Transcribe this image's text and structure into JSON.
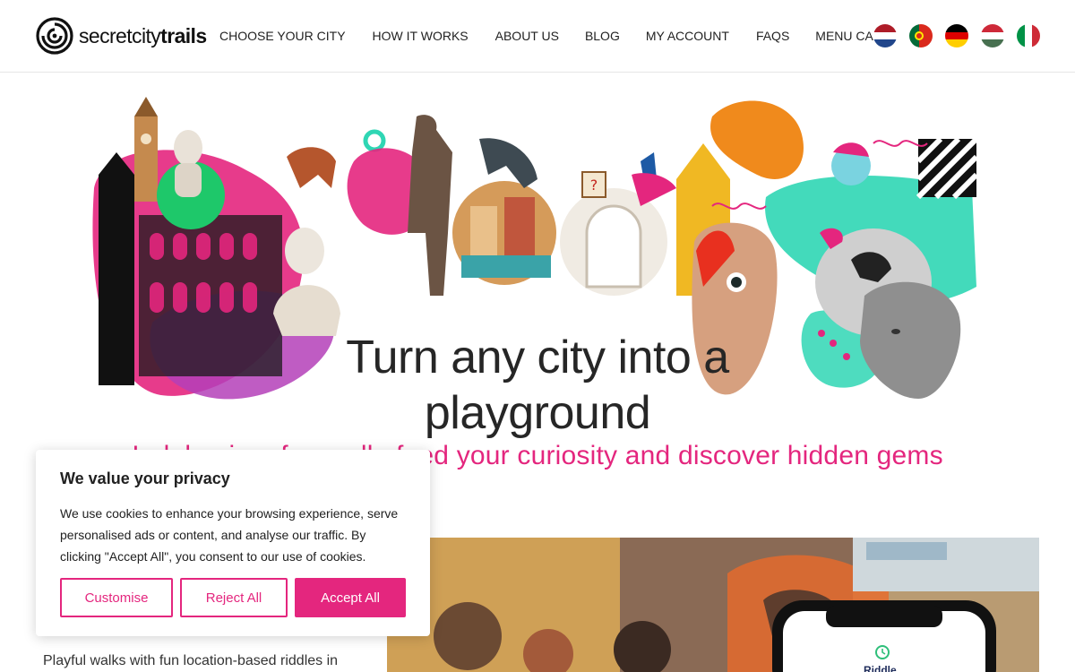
{
  "brand": {
    "name_light": "secret",
    "name_bold": "city",
    "name_end": "trails"
  },
  "nav": {
    "items": [
      "CHOOSE YOUR CITY",
      "HOW IT WORKS",
      "ABOUT US",
      "BLOG",
      "MY ACCOUNT",
      "FAQS",
      "MENU CART"
    ]
  },
  "languages": [
    {
      "code": "nl",
      "icon": "netherlands-flag-icon"
    },
    {
      "code": "pt",
      "icon": "portugal-flag-icon"
    },
    {
      "code": "de",
      "icon": "germany-flag-icon"
    },
    {
      "code": "hu",
      "icon": "hungary-flag-icon"
    },
    {
      "code": "it",
      "icon": "italy-flag-icon"
    }
  ],
  "hero": {
    "headline_line1": "Turn any city into a",
    "headline_line2": "playground",
    "subheadline": "Indulge in a fun walk, feed your curiosity and discover hidden gems"
  },
  "intro": {
    "text": "Playful walks with fun location-based riddles in"
  },
  "phone": {
    "label": "Riddle"
  },
  "cookie_banner": {
    "title": "We value your privacy",
    "text": "We use cookies to enhance your browsing experience, serve personalised ads or content, and analyse our traffic. By clicking \"Accept All\", you consent to our use of cookies.",
    "customise_label": "Customise",
    "reject_label": "Reject All",
    "accept_label": "Accept All"
  },
  "colors": {
    "accent": "#e4267e",
    "teal": "#2fd6b4",
    "green": "#1ec86a",
    "text": "#222222"
  }
}
